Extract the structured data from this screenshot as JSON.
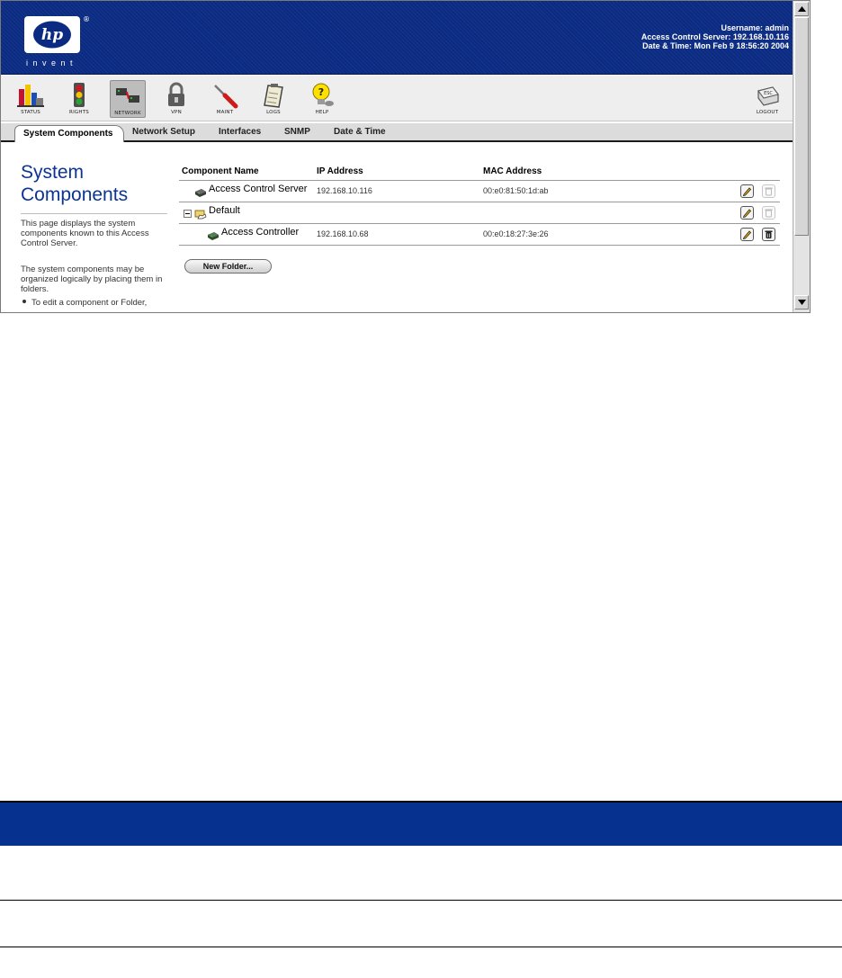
{
  "header": {
    "logo_mark": "hp",
    "logo_word": "invent",
    "logo_registered": "®",
    "username_line": "Username: admin",
    "server_line": "Access Control Server: 192.168.10.116",
    "datetime_line": "Date & Time: Mon Feb 9 18:56:20 2004",
    "brand_color": "#0b2b83"
  },
  "toolbar": {
    "items": [
      {
        "label": "STATUS",
        "icon": "status-chart-icon"
      },
      {
        "label": "RIGHTS",
        "icon": "traffic-light-icon"
      },
      {
        "label": "NETWORK",
        "icon": "network-icon",
        "active": true
      },
      {
        "label": "VPN",
        "icon": "padlock-icon"
      },
      {
        "label": "MAINT",
        "icon": "screwdriver-icon"
      },
      {
        "label": "LOGS",
        "icon": "clipboard-icon"
      },
      {
        "label": "HELP",
        "icon": "lightbulb-question-icon"
      },
      {
        "label": "LOGOUT",
        "icon": "logout-key-icon"
      }
    ]
  },
  "tabs": [
    {
      "label": "System Components",
      "active": true
    },
    {
      "label": "Network Setup"
    },
    {
      "label": "Interfaces"
    },
    {
      "label": "SNMP"
    },
    {
      "label": "Date & Time"
    }
  ],
  "side": {
    "title": "System Components",
    "para1": "This page displays the system components known to this Access Control Server.",
    "para2": "The system components may be organized logically by placing them in folders.",
    "bullet": "To edit a component or Folder,"
  },
  "table": {
    "columns": [
      "Component Name",
      "IP Address",
      "MAC Address"
    ],
    "rows": [
      {
        "name": "Access Control Server",
        "ip": "192.168.10.116",
        "mac": "00:e0:81:50:1d:ab",
        "kind": "device",
        "delete_enabled": false
      },
      {
        "name": "Default",
        "ip": "",
        "mac": "",
        "kind": "folder",
        "delete_enabled": false
      },
      {
        "name": "Access Controller",
        "ip": "192.168.10.68",
        "mac": "00:e0:18:27:3e:26",
        "kind": "device",
        "delete_enabled": true
      }
    ],
    "new_folder_label": "New Folder..."
  }
}
